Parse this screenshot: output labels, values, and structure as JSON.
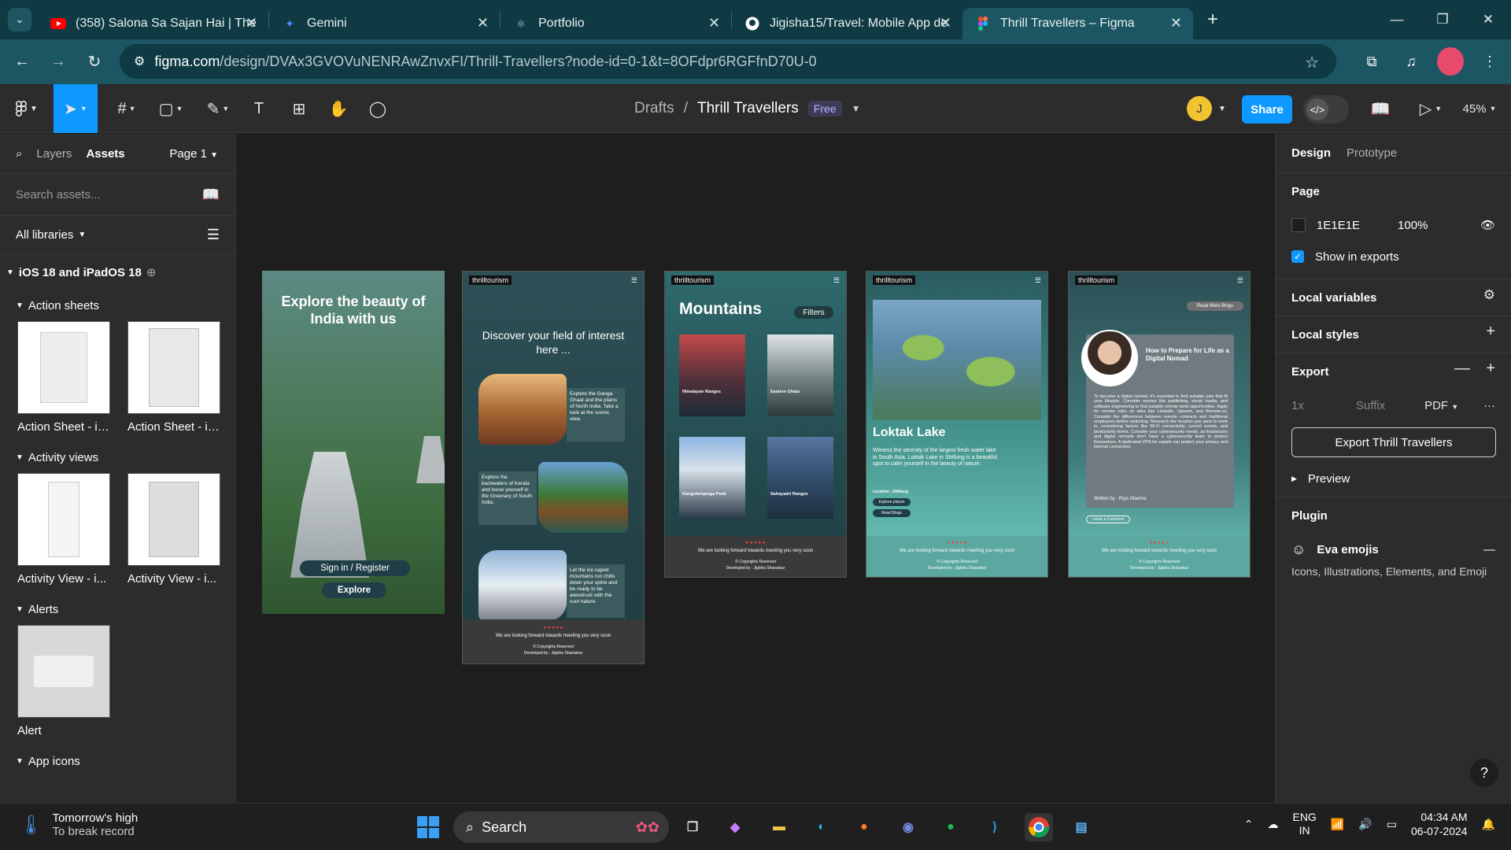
{
  "browser": {
    "tabs": [
      {
        "title": "(358) Salona Sa Sajan Hai | The",
        "icon": "youtube-icon",
        "color": "#ff0000"
      },
      {
        "title": "Gemini",
        "icon": "gemini-icon",
        "color": "#4f8dff"
      },
      {
        "title": "Portfolio",
        "icon": "react-icon",
        "color": "#9ad"
      },
      {
        "title": "Jigisha15/Travel: Mobile App de",
        "icon": "github-icon",
        "color": "#fff"
      },
      {
        "title": "Thrill Travellers – Figma",
        "icon": "figma-icon",
        "color": "#f24e1e"
      }
    ],
    "url_host": "figma.com",
    "url_path": "/design/DVAx3GVOVuNENRAwZnvxFI/Thrill-Travellers?node-id=0-1&t=8OFdpr6RGFfnD70U-0"
  },
  "toolbar": {
    "breadcrumb_parent": "Drafts",
    "file_name": "Thrill Travellers",
    "plan_badge": "Free",
    "avatar_initial": "J",
    "share_label": "Share",
    "zoom": "45%"
  },
  "left_panel": {
    "tab_layers": "Layers",
    "tab_assets": "Assets",
    "page_selector": "Page 1",
    "search_placeholder": "Search assets...",
    "libraries": "All libraries",
    "library_name": "iOS 18 and iPadOS 18",
    "groups": [
      {
        "name": "Action sheets",
        "items": [
          "Action Sheet - iP...",
          "Action Sheet - iP..."
        ]
      },
      {
        "name": "Activity views",
        "items": [
          "Activity View - i...",
          "Activity View - i..."
        ]
      },
      {
        "name": "Alerts",
        "items": [
          "Alert"
        ]
      },
      {
        "name": "App icons",
        "items": []
      }
    ]
  },
  "frames": {
    "f1": {
      "headline": "Explore the beauty of India with us",
      "signin": "Sign in / Register",
      "explore": "Explore"
    },
    "f2": {
      "brand": "thrilltourism",
      "heading": "Discover your field of interest here ...",
      "cards": [
        "Explore the Ganga Ghaat and the plains of North India. Take a look at the scenic view.",
        "Explore the backwaters of Kerala and loose yourself in the Greenary of South India.",
        "Let the ice caped mountains run chills down your spine and be ready to be awestruck with the cool nature."
      ],
      "footer": "We are looking forward towards meeting you very soon",
      "copyright": "© Copyrights Reserved",
      "dev": "Developed by : Jigisha Sharaskar"
    },
    "f3": {
      "brand": "thrilltourism",
      "title": "Mountains",
      "filters": "Filters",
      "items": [
        "Himalayan Ranges",
        "Eastern Ghats",
        "Kangchenjunga Peak",
        "Sahayadri Ranges"
      ],
      "footer": "We are looking forward towards meeting you very soon",
      "copyright": "© Copyrights Reserved",
      "dev": "Developed by : Jigisha Sharaskar"
    },
    "f4": {
      "brand": "thrilltourism",
      "title": "Loktak Lake",
      "desc": "Witness the serenity of the largest fresh water lake in South Asia. Loktak Lake in Shillong is a beautiful spot to calm yourself in the beauty of nature.",
      "location": "Location : Shillong",
      "btn1": "Explore places",
      "btn2": "Read Blogs",
      "footer": "We are looking forward towards meeting you very soon",
      "copyright": "© Copyrights Reserved",
      "dev": "Developed by : Jigisha Sharaskar"
    },
    "f5": {
      "brand": "thrilltourism",
      "read_more": "Read More Blogs",
      "blog_title": "How to Prepare for Life as a Digital Nomad",
      "blog_body": "To become a digital nomad, it's essential to find suitable jobs that fit your lifestyle. Consider sectors like publishing, social media, and software engineering to find suitable remote work opportunities. Apply for remote roles on sites like LinkedIn, Upwork, and Remote.co. Consider the differences between remote contracts and traditional employees before switching. Research the location you want to work in, considering factors like Wi-Fi connectivity, current events, and productivity levels. Consider your cybersecurity needs, as freelancers and digital nomads don't have a cybersecurity team to protect themselves. A dedicated VPN for expats can protect your privacy and internet connection.",
      "author": "Written by : Riya Sharma",
      "comment": "Leave a Comment",
      "footer": "We are looking forward towards meeting you very soon",
      "copyright": "© Copyrights Reserved",
      "dev": "Developed by : Jigisha Sharaskar"
    }
  },
  "right_panel": {
    "tab_design": "Design",
    "tab_prototype": "Prototype",
    "page_title": "Page",
    "page_color": "1E1E1E",
    "page_opacity": "100%",
    "show_in_exports": "Show in exports",
    "local_variables": "Local variables",
    "local_styles": "Local styles",
    "export_title": "Export",
    "export_scale": "1x",
    "export_suffix": "Suffix",
    "export_format": "PDF",
    "export_button": "Export Thrill Travellers",
    "preview": "Preview",
    "plugin_title": "Plugin",
    "plugin_name": "Eva emojis",
    "plugin_desc": "Icons, Illustrations, Elements, and Emoji"
  },
  "taskbar": {
    "weather_title": "Tomorrow's high",
    "weather_sub": "To break record",
    "search": "Search",
    "lang": "ENG",
    "region": "IN",
    "time": "04:34 AM",
    "date": "06-07-2024"
  },
  "colors": {
    "accent": "#0d99ff",
    "chrome_dark": "#0f3a44",
    "chrome": "#1d5663",
    "frame_teal": "#2b4d4f",
    "frame_aqua": "#6fc9bc"
  }
}
